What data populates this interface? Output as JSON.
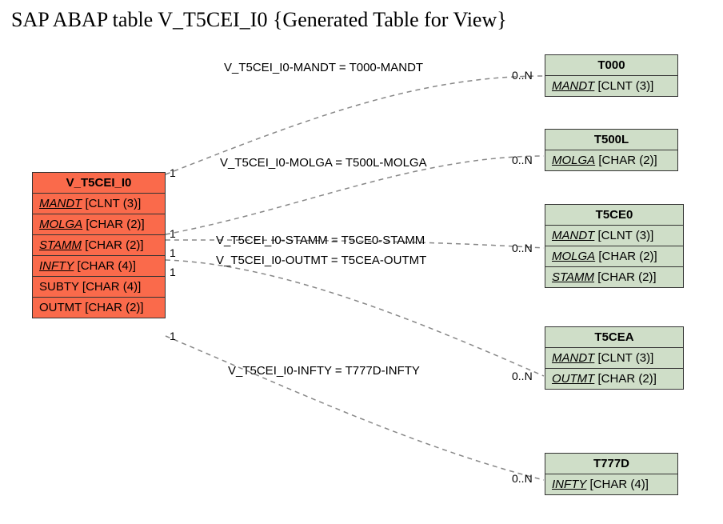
{
  "page_title": "SAP ABAP table V_T5CEI_I0 {Generated Table for View}",
  "main_entity": {
    "name": "V_T5CEI_I0",
    "fields": [
      {
        "name": "MANDT",
        "type": "CLNT (3)",
        "key": true
      },
      {
        "name": "MOLGA",
        "type": "CHAR (2)",
        "key": true
      },
      {
        "name": "STAMM",
        "type": "CHAR (2)",
        "key": true
      },
      {
        "name": "INFTY",
        "type": "CHAR (4)",
        "key": true
      },
      {
        "name": "SUBTY",
        "type": "CHAR (4)",
        "key": false
      },
      {
        "name": "OUTMT",
        "type": "CHAR (2)",
        "key": false
      }
    ]
  },
  "ref_entities": [
    {
      "name": "T000",
      "fields": [
        {
          "name": "MANDT",
          "type": "CLNT (3)",
          "key": true
        }
      ]
    },
    {
      "name": "T500L",
      "fields": [
        {
          "name": "MOLGA",
          "type": "CHAR (2)",
          "key": true
        }
      ]
    },
    {
      "name": "T5CE0",
      "fields": [
        {
          "name": "MANDT",
          "type": "CLNT (3)",
          "key": true
        },
        {
          "name": "MOLGA",
          "type": "CHAR (2)",
          "key": true
        },
        {
          "name": "STAMM",
          "type": "CHAR (2)",
          "key": true
        }
      ]
    },
    {
      "name": "T5CEA",
      "fields": [
        {
          "name": "MANDT",
          "type": "CLNT (3)",
          "key": true
        },
        {
          "name": "OUTMT",
          "type": "CHAR (2)",
          "key": true
        }
      ]
    },
    {
      "name": "T777D",
      "fields": [
        {
          "name": "INFTY",
          "type": "CHAR (4)",
          "key": true
        }
      ]
    }
  ],
  "relations": [
    {
      "label": "V_T5CEI_I0-MANDT = T000-MANDT",
      "from_card": "1",
      "to_card": "0..N"
    },
    {
      "label": "V_T5CEI_I0-MOLGA = T500L-MOLGA",
      "from_card": "1",
      "to_card": "0..N"
    },
    {
      "label": "V_T5CEI_I0-STAMM = T5CE0-STAMM",
      "from_card": "1",
      "to_card": "0..N"
    },
    {
      "label": "V_T5CEI_I0-OUTMT = T5CEA-OUTMT",
      "from_card": "1",
      "to_card": "0..N"
    },
    {
      "label": "V_T5CEI_I0-INFTY = T777D-INFTY",
      "from_card": "1",
      "to_card": "0..N"
    }
  ]
}
